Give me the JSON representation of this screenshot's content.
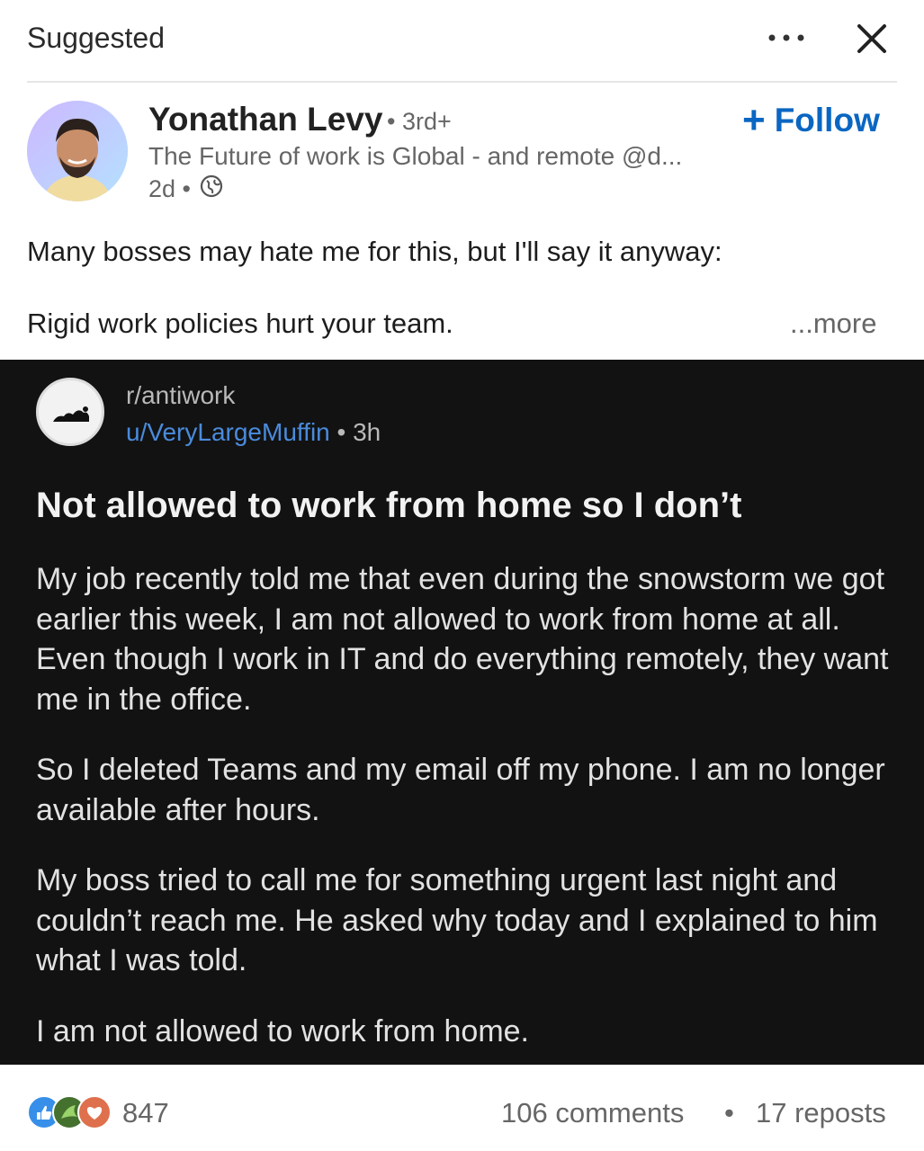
{
  "header": {
    "label": "Suggested"
  },
  "author": {
    "name": "Yonathan Levy",
    "degree": "• 3rd+",
    "headline": "The Future of work is Global - and remote @d...",
    "time": "2d •",
    "follow_label": "Follow",
    "follow_plus": "+"
  },
  "post": {
    "line1": "Many bosses may hate me for this, but I'll say it anyway:",
    "line2": "Rigid work policies hurt your team.",
    "more": "...more"
  },
  "reddit": {
    "subreddit": "r/antiwork",
    "user": "u/VeryLargeMuffin",
    "time": " • 3h",
    "title": "Not allowed to work from home so I don’t",
    "paragraphs": [
      "My job recently told me that even during the snowstorm we got earlier this week, I am not allowed to work from home at all. Even though I work in IT and do everything remotely, they want me in the office.",
      "So I deleted Teams and my email off my phone. I am no longer available after hours.",
      "My boss tried to call me for something urgent last night and couldn’t reach me. He asked why today and I explained to him what I was told.",
      "I am not allowed to work from home."
    ]
  },
  "footer": {
    "reaction_count": "847",
    "comments": "106 comments",
    "separator": "•",
    "reposts": "17 reposts"
  },
  "colors": {
    "accent": "#0a66c2",
    "reddit_bg": "#121212",
    "reddit_user": "#4a8bdc"
  }
}
